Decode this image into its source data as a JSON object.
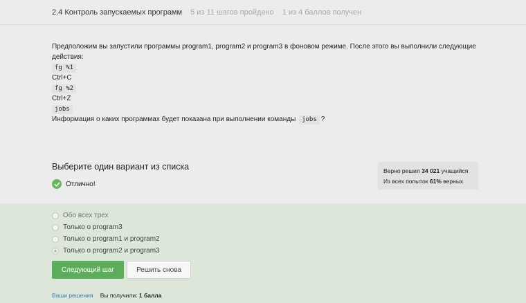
{
  "header": {
    "title": "2.4 Контроль запускаемых программ",
    "steps_progress": "5 из 11 шагов пройдено",
    "score": "1 из 4 баллов  получен"
  },
  "task": {
    "intro": "Предположим вы запустили программы program1, program2 и program3 в фоновом режиме. После этого вы выполнили следующие действия:",
    "actions": [
      {
        "type": "code",
        "text": "fg %1"
      },
      {
        "type": "text",
        "text": "Ctrl+C"
      },
      {
        "type": "code",
        "text": "fg %2"
      },
      {
        "type": "text",
        "text": "Ctrl+Z"
      },
      {
        "type": "code",
        "text": "jobs"
      }
    ],
    "question_before": "Информация о каких программах будет показана при выполнении команды",
    "question_code": "jobs",
    "question_after": "?"
  },
  "quiz": {
    "choose_label": "Выберите один вариант из списка",
    "result_label": "Отлично!",
    "options": [
      {
        "label": "Обо всех трех",
        "selected": false
      },
      {
        "label": "Только о program3",
        "selected": false
      },
      {
        "label": "Только о program1 и program2",
        "selected": false
      },
      {
        "label": "Только о program2 и program3",
        "selected": true
      }
    ]
  },
  "stats": {
    "solved_prefix": "Верно решил",
    "solved_count": "34 021",
    "solved_suffix": "учащийся",
    "attempts_prefix": "Из всех попыток",
    "attempts_pct": "61%",
    "attempts_suffix": "верных"
  },
  "buttons": {
    "next": "Следующий шаг",
    "retry": "Решить снова"
  },
  "footer": {
    "solutions_link": "Ваши решения",
    "received_label": "Вы получили:",
    "received_value": "1 балла"
  },
  "colors": {
    "accent_green": "#5cad5a",
    "panel_green": "#dce7d9",
    "link": "#3d76b5"
  }
}
